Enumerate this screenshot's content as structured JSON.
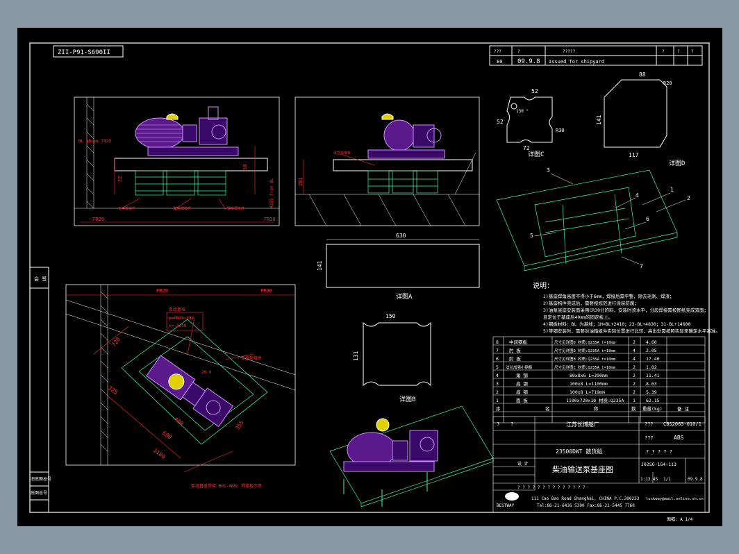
{
  "drawing_number_box": "ZII-P91-S690II",
  "revision_table": {
    "header": [
      "???",
      "?",
      "?????",
      "?",
      "?",
      "?",
      "?"
    ],
    "row": [
      "E0",
      "09.9.8",
      "Issued for shipyard"
    ]
  },
  "detail_c": {
    "label": "详图C",
    "top": "52",
    "side": "52",
    "bottom": "72",
    "angle": "R30",
    "hole": "130 °"
  },
  "detail_d_top": {
    "label": "详图D",
    "top": "88",
    "side": "141",
    "bottom": "117",
    "angle": "R20"
  },
  "detail_a": {
    "label": "详图A",
    "width": "630",
    "height": "141"
  },
  "detail_b": {
    "label": "详图B",
    "width": "150",
    "height": "131"
  },
  "elevation": {
    "frame_left": "FR29",
    "frame_right": "FR30",
    "dim_height": "229",
    "dim_side": "72",
    "dim_right": "50",
    "bl_note": "BL above 7429",
    "from_bl": "4255 from BL",
    "label_a": "支撑板组件",
    "label_b": "基座焊接件",
    "label_c": "钢板焊接件"
  },
  "end_view": {
    "dim": "281",
    "label": "法兰焊接板"
  },
  "plan": {
    "frame": "FR29",
    "frame2": "FR30",
    "note_title": "泵组基准",
    "note_lines": [
      "y=FR29-132",
      "x=-3348"
    ],
    "dims": [
      "1100",
      "600",
      "400",
      "728",
      "325",
      "355",
      "20.0"
    ],
    "side_label": "支撑焊接件",
    "bottom_label": "泵组基座焊接  BHS-48BL  焊接板示意"
  },
  "notes": {
    "title": "说明：",
    "lines": [
      "1)基座焊角高度不得小于6mm，焊接后需平整，除去毛刺、焊渣；",
      "2)基座构件完成后，需要按规范进行涂装防腐；",
      "3)油泵底座安装面采用CR30分的料，安装时须水平，分段焊接需按图纸完成双面；",
      "且定位于基座后40mm的固定板上。",
      "4)钢板材料：BL 为基线；1H=BL+2410；23-BL+4830；31-BL+14600",
      "5)等钢安装时，需要对油箱组件实际位置进行比较，高出处需按照实际来确定水平基准。"
    ]
  },
  "parts_table": {
    "rows": [
      [
        "8",
        "中间钢板",
        "尺寸见详图D  材质:Q235A t=10mm",
        "2",
        "4.60"
      ],
      [
        "7",
        "肘 板",
        "尺寸见详图D  材质:Q235A t=10mm",
        "4",
        "2.05"
      ],
      [
        "6",
        "肘 板",
        "尺寸见详图B  材质:Q235A t=10mm",
        "4",
        "17.40"
      ],
      [
        "5",
        "法兰加强小钢板",
        "尺寸见详图C  材质:Q235A t=10mm",
        "2",
        "1.82"
      ],
      [
        "4",
        "角 钢",
        "80x8x6 L=390mm",
        "2",
        "11.41"
      ],
      [
        "3",
        "扁 钢",
        "100x8 L=1100mm",
        "2",
        "8.63"
      ],
      [
        "2",
        "扁 钢",
        "100x8 L=719mm",
        "2",
        "5.39"
      ],
      [
        "1",
        "面 板",
        "1100x720x10 材质:Q235A",
        "1",
        "62.15"
      ]
    ],
    "header": [
      "序",
      "名",
      "称",
      "数",
      "重量(kg)",
      "备 注"
    ]
  },
  "title_block": {
    "company": "江苏长博船厂",
    "project_code": "CBS2065-010/1",
    "class": "ABS",
    "ship": "23500DWT 散货船",
    "drawing_title": "柴油输送泵基座图",
    "drawing_no": "J02SG-1G4-113",
    "scale": "1:13.45",
    "sheet": "1/1",
    "date": "09.9.8",
    "design": "设 计",
    "placeholders": [
      "?",
      "?",
      "???",
      "? ? ? ? ?",
      "? ? ? ? ? ? ? ? ? ? ? ? ? ?"
    ],
    "address": "111 Cao Bao Road Shanghai, CHINA  P.C.200233",
    "phone": "Tel:86-21-6436 5300  Fax:86-21-5445 7760",
    "email": "luckway@mail.online.sh.cn",
    "brand": "BESTWAY"
  },
  "left_strip": {
    "label_a": "会 签",
    "label_b": "旧底图总号",
    "label_c": "底图总号"
  },
  "bottom_right": "图幅:  A 1/4"
}
